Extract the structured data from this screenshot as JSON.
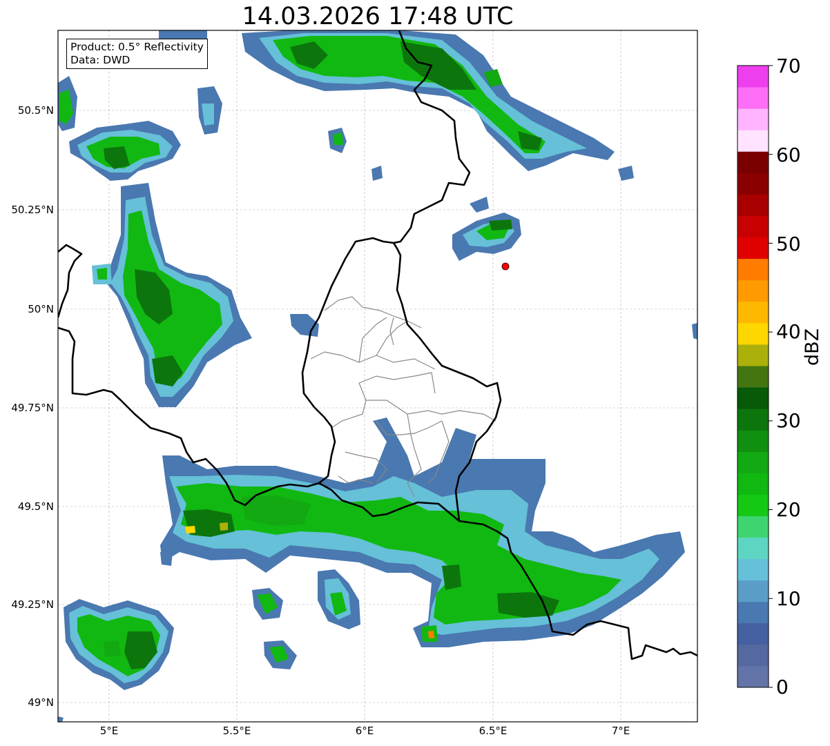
{
  "title": "14.03.2026 17:48 UTC",
  "info": {
    "product": "Product: 0.5° Reflectivity",
    "data_source": "Data: DWD"
  },
  "axes": {
    "x_ticks": [
      "5°E",
      "5.5°E",
      "6°E",
      "6.5°E",
      "7°E"
    ],
    "y_ticks": [
      "50.5°N",
      "50.25°N",
      "50°N",
      "49.75°N",
      "49.5°N",
      "49.25°N",
      "49°N"
    ],
    "lon_range": [
      4.8,
      7.3
    ],
    "lat_range": [
      48.95,
      50.7
    ],
    "grid": true
  },
  "radar_site": {
    "lon": 6.55,
    "lat": 50.11,
    "color": "#ff0000"
  },
  "colorbar": {
    "label": "dBZ",
    "range": [
      0,
      70
    ],
    "tick_labels": [
      "70",
      "60",
      "50",
      "40",
      "30",
      "20",
      "10",
      "0"
    ],
    "colors": [
      "#6374a8",
      "#55689f",
      "#4560a0",
      "#4a78b0",
      "#5a9ec8",
      "#65c0d8",
      "#5ed5c3",
      "#3ed570",
      "#14c814",
      "#11b811",
      "#12a912",
      "#108f10",
      "#0c760c",
      "#075a07",
      "#437611",
      "#acb00b",
      "#ffd700",
      "#ffb800",
      "#ff9b00",
      "#ff7c00",
      "#e00000",
      "#c80000",
      "#a80000",
      "#8a0000",
      "#7a0000",
      "#ffe3ff",
      "#ffb4ff",
      "#ff6ef6",
      "#ee3fee"
    ]
  }
}
